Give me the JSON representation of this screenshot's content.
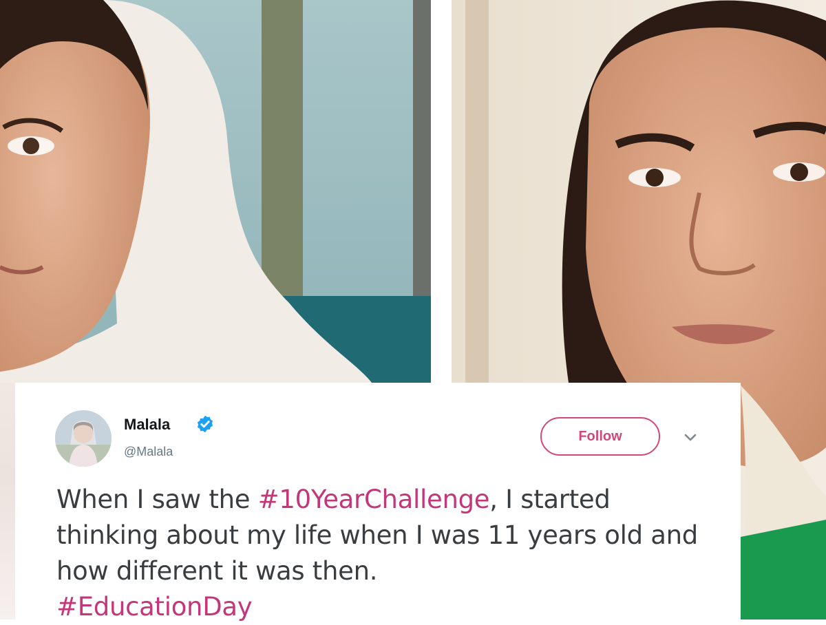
{
  "tweet": {
    "author_name": "Malala",
    "author_handle": "@Malala",
    "verified_icon": "verified-badge-icon",
    "follow_label": "Follow",
    "menu_icon": "chevron-down-icon",
    "text_parts": {
      "p1": "When I saw the ",
      "hashtag1": "#10YearChallenge",
      "p2": ", I started thinking about my life when I was 11 years old and how different it was then.",
      "hashtag2": "#EducationDay"
    }
  },
  "colors": {
    "accent": "#c3367a",
    "follow_border": "#d1477a",
    "verified": "#1da1f2",
    "text": "#3a3d40",
    "handle": "#657786"
  }
}
